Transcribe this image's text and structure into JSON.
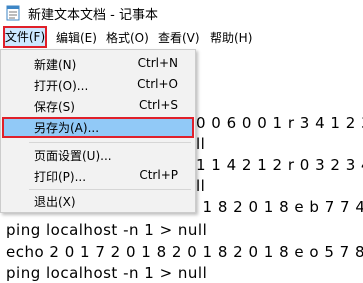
{
  "window": {
    "title": "新建文本文档 - 记事本",
    "icon": "notepad-icon"
  },
  "menubar": {
    "items": [
      "文件(F)",
      "编辑(E)",
      "格式(O)",
      "查看(V)",
      "帮助(H)"
    ]
  },
  "file_menu": {
    "items": [
      {
        "label": "新建(N)",
        "shortcut": "Ctrl+N"
      },
      {
        "label": "打开(O)...",
        "shortcut": "Ctrl+O"
      },
      {
        "label": "保存(S)",
        "shortcut": "Ctrl+S"
      },
      {
        "label": "另存为(A)...",
        "shortcut": ""
      },
      {
        "label": "页面设置(U)...",
        "shortcut": ""
      },
      {
        "label": "打印(P)...",
        "shortcut": "Ctrl+P"
      },
      {
        "label": "退出(X)",
        "shortcut": ""
      }
    ]
  },
  "editor": {
    "partial_lines": [
      "0 0 6 0 0 1 r 3 4 1 2 3",
      "ll",
      "1 1 4 2 1 2 r 0 3 2 3 4",
      "ll"
    ],
    "lines": [
      "echo 2 0 1 7 2 0 1 8 2 0 1 8 2 0 1 8 e b 7 7 4 4",
      "ping localhost -n 1 > null",
      "echo 2 0 1 7 2 0 1 8 2 0 1 8 2 0 1 8 e o 5 7 8 4",
      "ping localhost -n 1 > null"
    ]
  },
  "colors": {
    "highlight_box": "#e0202a",
    "menu_selected": "#cce8ff",
    "item_hover": "#91c9f7"
  }
}
